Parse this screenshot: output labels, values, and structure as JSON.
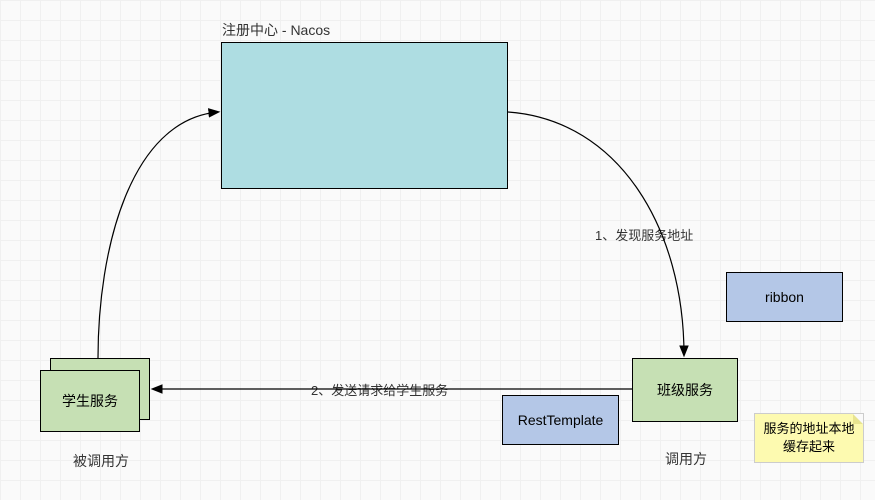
{
  "title": "注册中心 - Nacos",
  "nodes": {
    "nacos": "",
    "student_service": "学生服务",
    "class_service": "班级服务",
    "ribbon": "ribbon",
    "rest_template": "RestTemplate"
  },
  "labels": {
    "callee": "被调用方",
    "caller": "调用方"
  },
  "note": "服务的地址本地缓存起来",
  "arrows": {
    "discover": "1、发现服务地址",
    "send_request": "2、发送请求给学生服务"
  }
}
